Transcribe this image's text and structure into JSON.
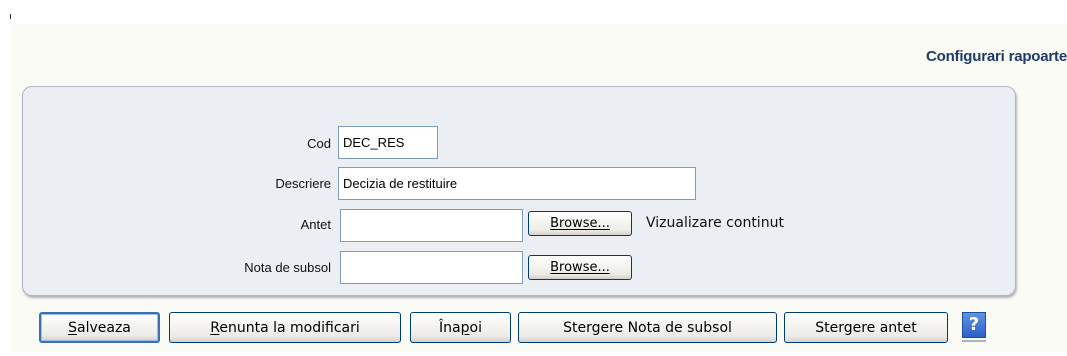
{
  "page": {
    "title": "Configurari rapoarte"
  },
  "form": {
    "cod": {
      "label": "Cod",
      "value": "DEC_RES"
    },
    "descriere": {
      "label": "Descriere",
      "value": "Decizia de restituire"
    },
    "antet": {
      "label": "Antet",
      "value": "",
      "browse_label": "Browse...",
      "view_link": "Vizualizare continut"
    },
    "nota_subsol": {
      "label": "Nota de subsol",
      "value": "",
      "browse_label": "Browse..."
    }
  },
  "actions": {
    "save": {
      "access_key": "S",
      "rest": "alveaza"
    },
    "discard": {
      "access_key": "R",
      "rest": "enunta la modificari"
    },
    "back": {
      "prefix": "Îna",
      "access_key": "p",
      "suffix": "oi"
    },
    "delete_footer": "Stergere Nota de subsol",
    "delete_header": "Stergere antet",
    "help": "?"
  },
  "colors": {
    "title": "#1f3b68",
    "panel_background": "#ebeef3",
    "button_border": "#003c74",
    "help_icon": "#2c61c9"
  }
}
